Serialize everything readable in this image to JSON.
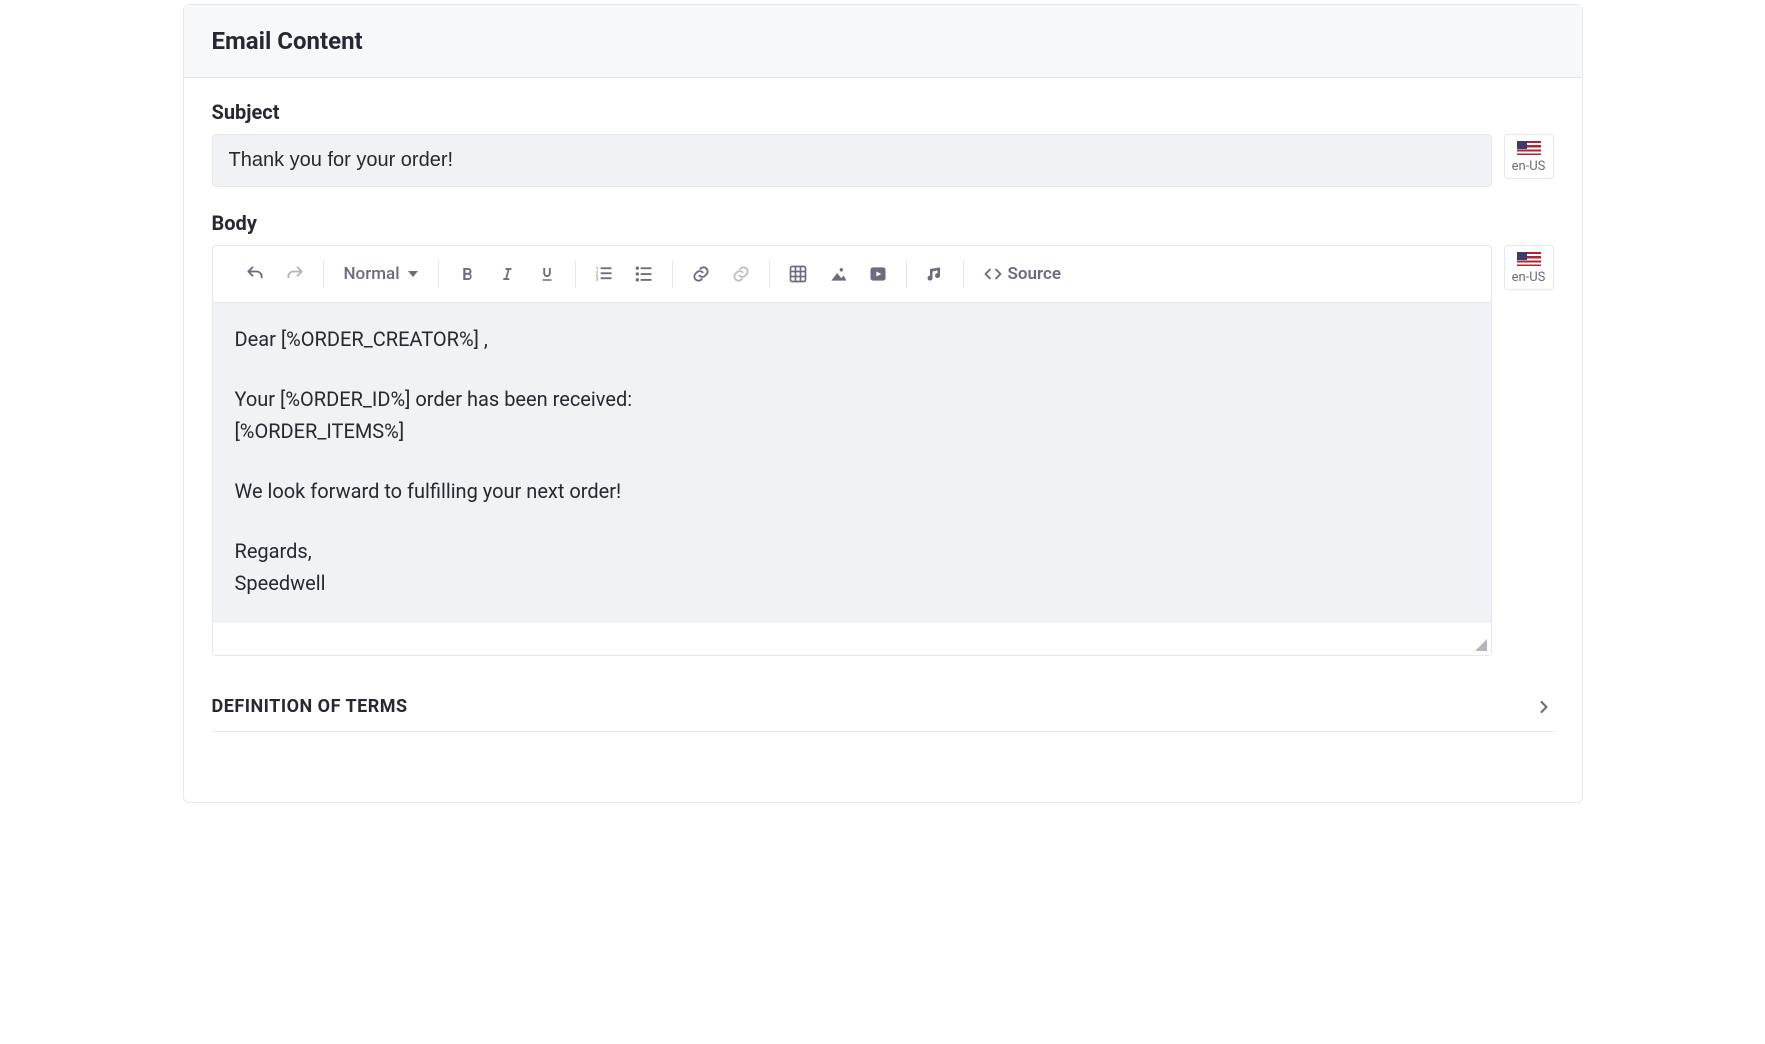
{
  "panel": {
    "title": "Email Content"
  },
  "subject": {
    "label": "Subject",
    "value": "Thank you for your order!"
  },
  "locale": {
    "code": "en-US"
  },
  "body": {
    "label": "Body",
    "content_lines": [
      "Dear [%ORDER_CREATOR%] ,",
      "",
      "Your [%ORDER_ID%] order has been received:",
      "[%ORDER_ITEMS%]",
      "",
      "We look forward to fulfilling your next order!",
      "",
      "Regards,",
      "Speedwell"
    ],
    "p1": "Dear [%ORDER_CREATOR%] ,",
    "p2_l1": "Your [%ORDER_ID%] order has been received:",
    "p2_l2": "[%ORDER_ITEMS%]",
    "p3": "We look forward to fulfilling your next order!",
    "p4_l1": "Regards,",
    "p4_l2": "Speedwell"
  },
  "toolbar": {
    "style_label": "Normal",
    "source_label": "Source"
  },
  "definitions": {
    "title": "DEFINITION OF TERMS"
  }
}
